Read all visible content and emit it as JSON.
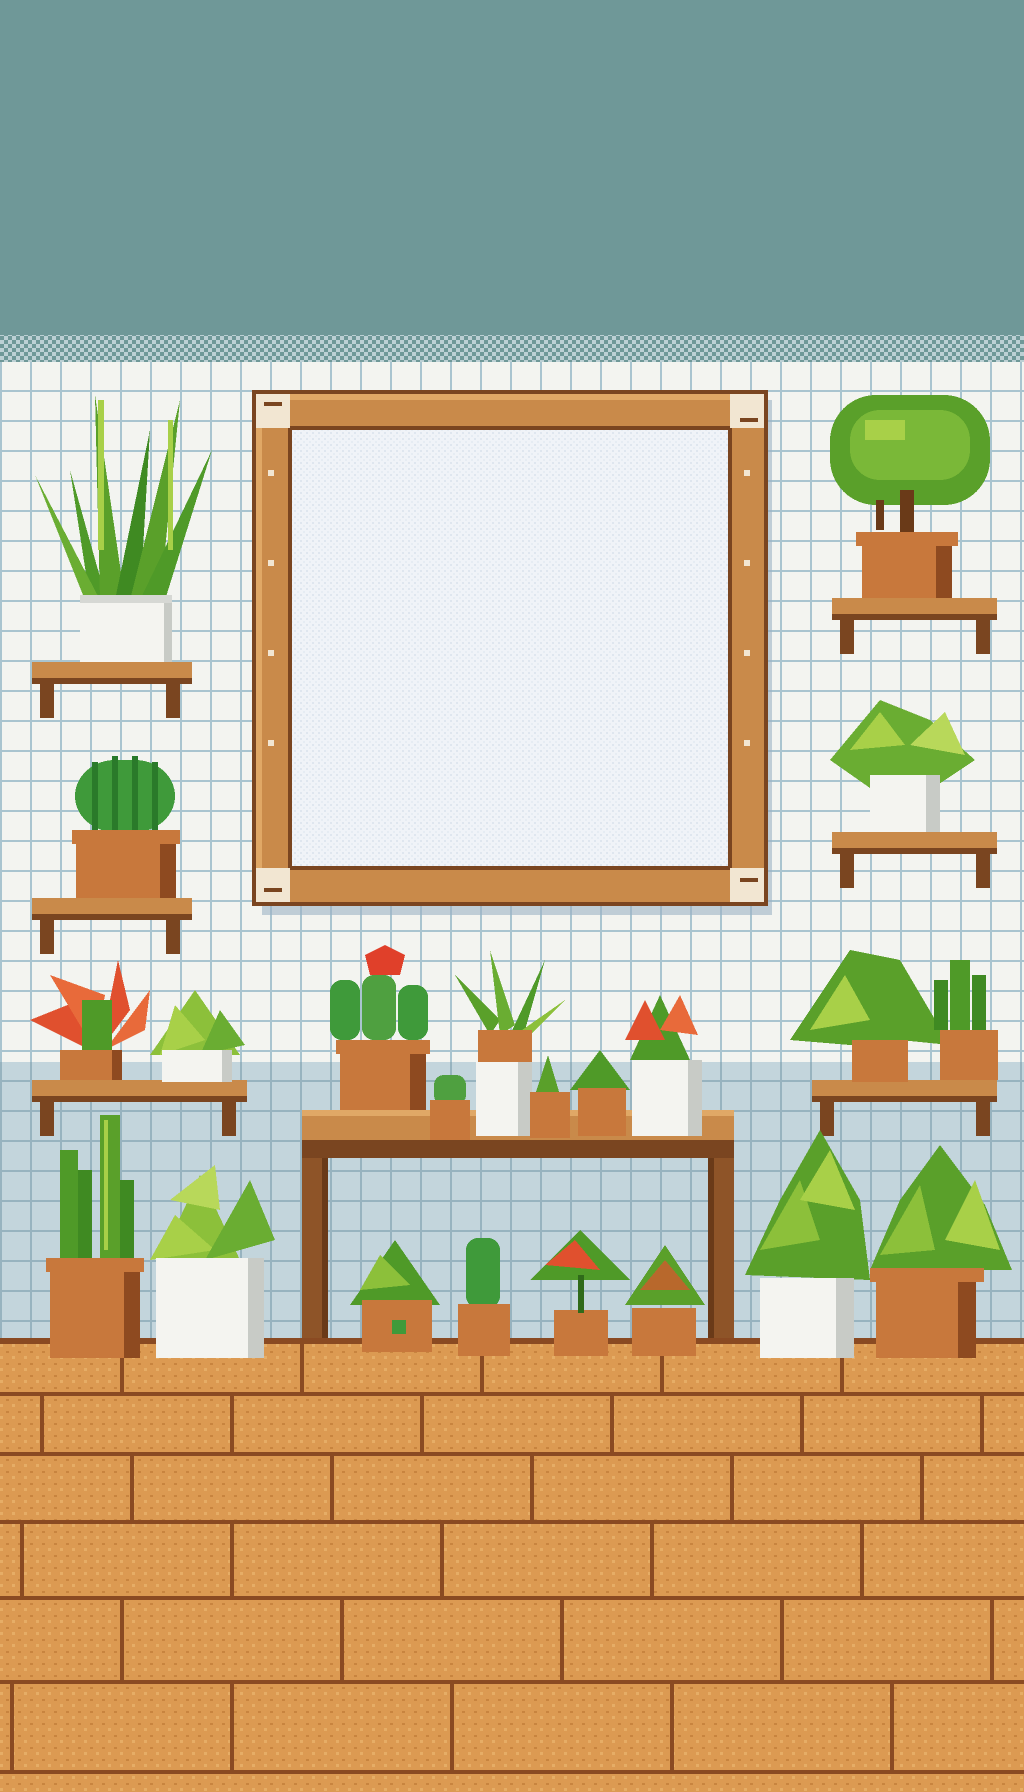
{
  "scene": {
    "type": "pixel-art room background",
    "objects": [
      "wall-tiles",
      "empty-wooden-frame",
      "wall-shelves",
      "wooden-table",
      "potted-plants",
      "brick-floor"
    ]
  },
  "palette": {
    "sky": "#6f9898",
    "tile": "#f3f4f0",
    "grout": "#a9c4cf",
    "lower_wall": "#c3d5dc",
    "wood": "#c98a4a",
    "wood_dark": "#7a4520",
    "terracotta": "#c8783c",
    "terracotta_dark": "#8e4a20",
    "white_pot": "#f4f4f0",
    "leaf": "#5aa02a",
    "leaf_dark": "#2f6a1a",
    "leaf_light": "#a8d048",
    "floor": "#dc9a52",
    "floor_line": "#8a4a22",
    "flower_red": "#e0502e",
    "canvas": "#f0f3f8"
  }
}
